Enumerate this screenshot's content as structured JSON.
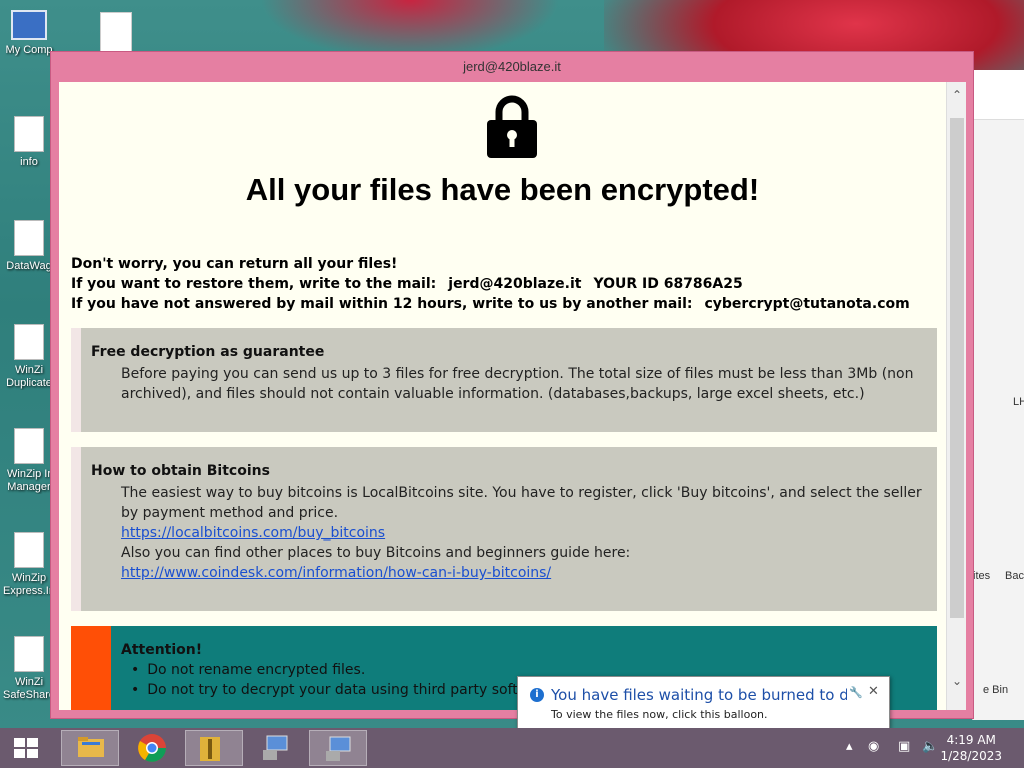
{
  "desktop": {
    "icons": [
      {
        "label": "My Comp"
      },
      {
        "label": "info"
      },
      {
        "label": "DataWag"
      },
      {
        "label": "WinZi Duplicate"
      },
      {
        "label": "WinZip Ir Manager"
      },
      {
        "label": "WinZip Express.In"
      },
      {
        "label": "WinZi SafeShare"
      }
    ]
  },
  "explorer": {
    "labels": [
      "LH",
      "ites",
      "Bac",
      "e Bin"
    ]
  },
  "ransom": {
    "window_title": "jerd@420blaze.it",
    "headline": "All your files have been encrypted!",
    "line1": "Don't worry, you can return all your files!",
    "line2_prefix": "If you want to restore them, write to the mail:",
    "line2_mail": "jerd@420blaze.it",
    "line2_id": "YOUR ID 68786A25",
    "line3_prefix": "If you have not answered by mail within 12 hours, write to us by another mail:",
    "line3_mail": "cybercrypt@tutanota.com",
    "free_title": "Free decryption as guarantee",
    "free_text": "Before paying you can send us up to 3 files for free decryption. The total size of files must be less than 3Mb (non archived), and files should not contain valuable information. (databases,backups, large excel sheets, etc.)",
    "btc_title": "How to obtain Bitcoins",
    "btc_text": "The easiest way to buy bitcoins is LocalBitcoins site. You have to register, click 'Buy bitcoins', and select the seller by payment method and price.",
    "btc_link1": "https://localbitcoins.com/buy_bitcoins",
    "btc_text2": "Also you can find other places to buy Bitcoins and beginners guide here:",
    "btc_link2": "http://www.coindesk.com/information/how-can-i-buy-bitcoins/",
    "attn_title": "Attention!",
    "attn_items": [
      "Do not rename encrypted files.",
      "Do not try to decrypt your data using third party software"
    ]
  },
  "balloon": {
    "title": "You have files waiting to be burned to disc",
    "subtitle": "To view the files now, click this balloon."
  },
  "taskbar": {
    "time": "4:19 AM",
    "date": "1/28/2023"
  },
  "colors": {
    "window_frame": "#e57fa2",
    "content_bg": "#fffff2",
    "box_grey": "#c9c9bf",
    "attention_bg": "#0f7d7b",
    "attention_bar": "#ff4f06",
    "link": "#1a4fd0"
  }
}
